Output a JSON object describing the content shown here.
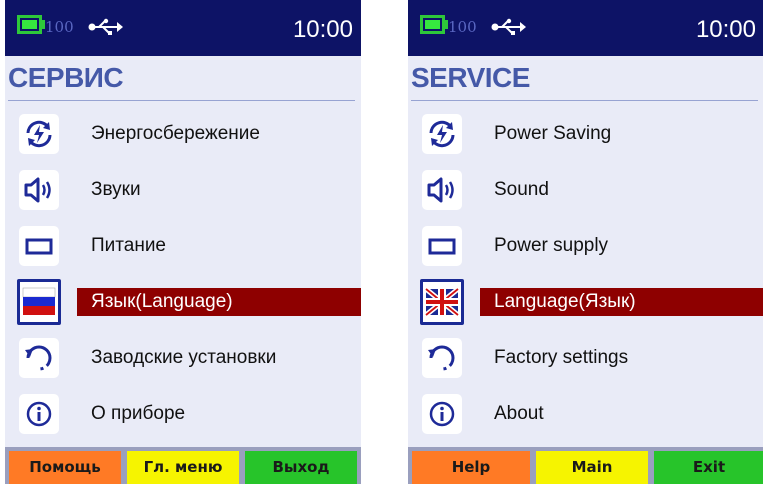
{
  "colors": {
    "statusbar_bg": "#0d1366",
    "screen_bg": "#e9ebf7",
    "title": "#4559a8",
    "selection": "#8e0000",
    "help_key": "#ff7a25",
    "main_key": "#f6f400",
    "exit_key": "#27c42a",
    "battery": "#36e83f"
  },
  "screens": [
    {
      "language": "ru",
      "status": {
        "battery_level": "100",
        "battery_percent": 100,
        "time": "10:00",
        "usb_icon": "usb-icon"
      },
      "title": "СЕРВИС",
      "items": [
        {
          "icon": "power-saving-icon",
          "label": "Энергосбережение",
          "selected": false
        },
        {
          "icon": "speaker-icon",
          "label": "Звуки",
          "selected": false
        },
        {
          "icon": "battery-outline-icon",
          "label": "Питание",
          "selected": false
        },
        {
          "icon": "russian-flag-icon",
          "label": "Язык(Language)",
          "selected": true
        },
        {
          "icon": "reset-icon",
          "label": "Заводские установки",
          "selected": false
        },
        {
          "icon": "info-icon",
          "label": "О приборе",
          "selected": false
        }
      ],
      "softkeys": {
        "help": "Помощь",
        "main": "Гл. меню",
        "exit": "Выход"
      }
    },
    {
      "language": "en",
      "status": {
        "battery_level": "100",
        "battery_percent": 100,
        "time": "10:00",
        "usb_icon": "usb-icon"
      },
      "title": "SERVICE",
      "items": [
        {
          "icon": "power-saving-icon",
          "label": "Power Saving",
          "selected": false
        },
        {
          "icon": "speaker-icon",
          "label": "Sound",
          "selected": false
        },
        {
          "icon": "battery-outline-icon",
          "label": "Power supply",
          "selected": false
        },
        {
          "icon": "uk-flag-icon",
          "label": "Language(Язык)",
          "selected": true
        },
        {
          "icon": "reset-icon",
          "label": "Factory settings",
          "selected": false
        },
        {
          "icon": "info-icon",
          "label": "About",
          "selected": false
        }
      ],
      "softkeys": {
        "help": "Help",
        "main": "Main",
        "exit": "Exit"
      }
    }
  ]
}
